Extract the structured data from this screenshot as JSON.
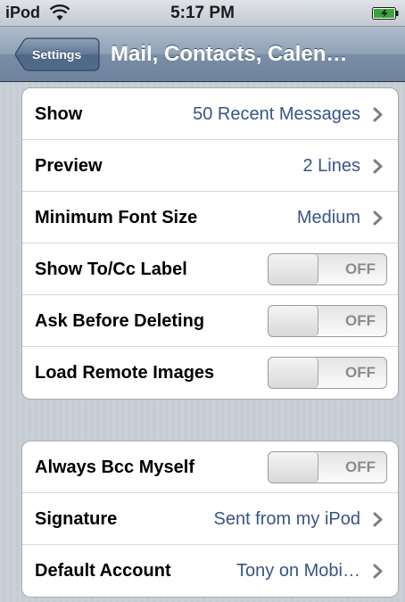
{
  "status_bar": {
    "carrier": "iPod",
    "time": "5:17 PM",
    "wifi_icon": "wifi-icon",
    "battery_icon": "battery-charging-icon"
  },
  "nav_bar": {
    "back_label": "Settings",
    "title": "Mail, Contacts, Calen…"
  },
  "groups": [
    {
      "rows": [
        {
          "label": "Show",
          "value": "50 Recent Messages",
          "type": "disclosure"
        },
        {
          "label": "Preview",
          "value": "2 Lines",
          "type": "disclosure"
        },
        {
          "label": "Minimum Font Size",
          "value": "Medium",
          "type": "disclosure"
        },
        {
          "label": "Show To/Cc Label",
          "value": "OFF",
          "type": "switch",
          "on": false
        },
        {
          "label": "Ask Before Deleting",
          "value": "OFF",
          "type": "switch",
          "on": false
        },
        {
          "label": "Load Remote Images",
          "value": "OFF",
          "type": "switch",
          "on": false
        }
      ]
    },
    {
      "rows": [
        {
          "label": "Always Bcc Myself",
          "value": "OFF",
          "type": "switch",
          "on": false
        },
        {
          "label": "Signature",
          "value": "Sent from my iPod",
          "type": "disclosure"
        },
        {
          "label": "Default Account",
          "value": "Tony on Mobi…",
          "type": "disclosure"
        }
      ]
    }
  ],
  "colors": {
    "value_text": "#385487",
    "nav_bar": "#7a8ea6",
    "background": "#c5ccd4"
  }
}
